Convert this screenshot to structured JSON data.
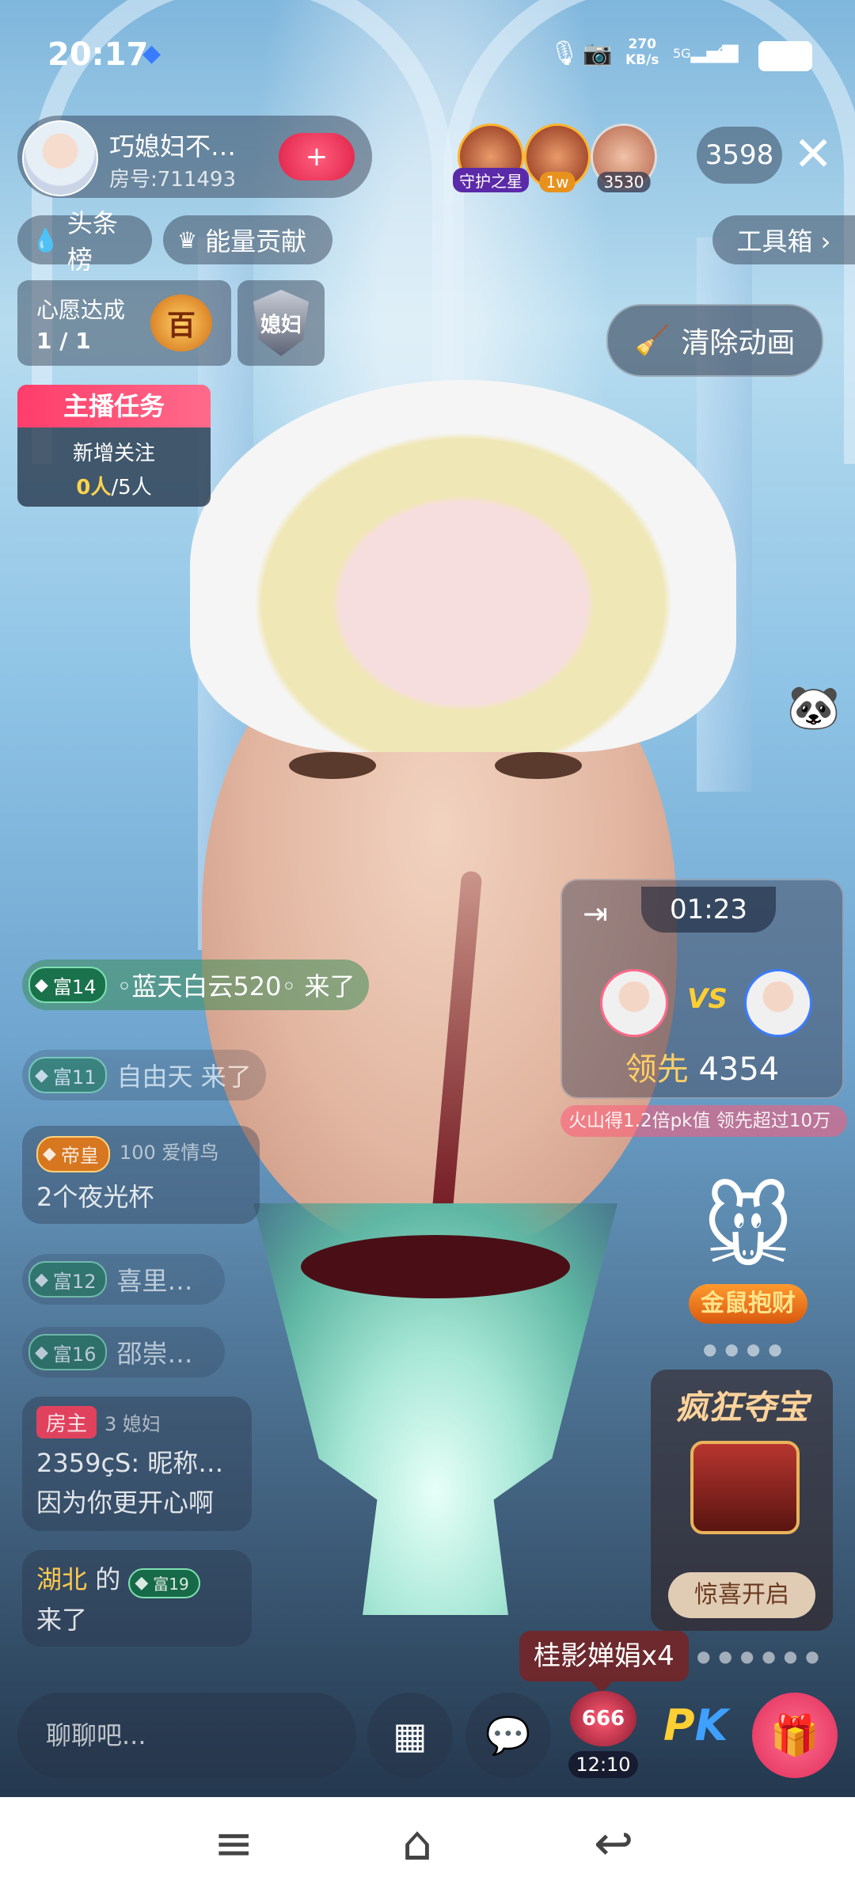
{
  "status_bar": {
    "time": "20:17",
    "net_speed_value": "270",
    "net_speed_unit": "KB/s",
    "network": "5G"
  },
  "host": {
    "name": "巧媳妇不…",
    "room_no": "房号:711493",
    "follow_icon": "+"
  },
  "viewers": [
    {
      "badge": "守护之星"
    },
    {
      "badge": "1w"
    },
    {
      "badge": "3530"
    }
  ],
  "audience_count": "3598",
  "top_pills": {
    "headline_rank": "头条榜",
    "energy_contrib": "能量贡献",
    "toolbox": "工具箱 ›"
  },
  "wish": {
    "title": "心愿达成",
    "progress": "1 / 1",
    "medal": "百"
  },
  "shield_text": "媳妇",
  "clear_anim": "清除动画",
  "anchor_task": {
    "title": "主播任务",
    "label": "新增关注",
    "current": "0人",
    "target": "/5人"
  },
  "pk": {
    "timer": "01:23",
    "vs": "VS",
    "lead_label": "领先",
    "lead_value": "4354",
    "ticker": "火山得1.2倍pk值   领先超过10万"
  },
  "chat": [
    {
      "level": "富14",
      "text": "◦蓝天白云520◦ 来了"
    },
    {
      "level": "富11",
      "text": "自由天 来了"
    },
    {
      "level": "帝皇",
      "extra": "100 爱情鸟",
      "text": "2个夜光杯"
    },
    {
      "level": "富12",
      "text": "喜里…"
    },
    {
      "level": "富16",
      "text": "邵崇…"
    }
  ],
  "chat_block": {
    "tag": "房主",
    "badge": "3 媳妇",
    "line1": "2359çS: 昵称…",
    "line2": "因为你更开心啊"
  },
  "chat_join": {
    "location": "湖北",
    "middle": " 的 ",
    "level": "富19",
    "line2": "来了"
  },
  "widgets": {
    "mouse_label": "金鼠抱财",
    "treasure_title": "疯狂夺宝",
    "treasure_button": "惊喜开启"
  },
  "gift_tip": "桂影婵娟x4",
  "bottom": {
    "input_placeholder": "聊聊吧...",
    "glory_level": "666",
    "glory_time": "12:10",
    "pk_p": "P",
    "pk_k": "K"
  }
}
